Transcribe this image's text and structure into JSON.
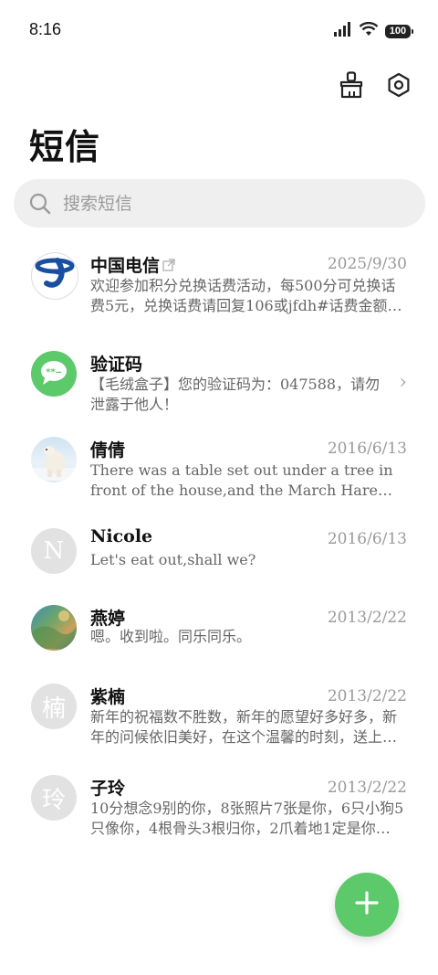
{
  "status": {
    "time": "8:16",
    "battery": "100"
  },
  "header": {
    "title": "短信"
  },
  "search": {
    "placeholder": "搜索短信"
  },
  "messages": [
    {
      "name": "中国电信",
      "date": "2025/9/30",
      "preview": "欢迎参加积分兑换话费活动，每500分可兑换话费5元，兑换话费请回复106或jfdh#话费金额…",
      "avatar": "china-telecom-logo"
    },
    {
      "name": "验证码",
      "date": "",
      "preview": "【毛绒盒子】您的验证码为：047588，请勿泄露于他人！",
      "avatar": "chat-bubble-icon"
    },
    {
      "name": "倩倩",
      "date": "2016/6/13",
      "preview": "There was a table set out under a tree in front of the house,and the March Hare and the Ha…",
      "avatar": "polar-bear-photo"
    },
    {
      "name": "Nicole",
      "date": "2016/6/13",
      "preview": "Let's eat out,shall we?",
      "avatar": "N"
    },
    {
      "name": "燕婷",
      "date": "2013/2/22",
      "preview": "嗯。收到啦。同乐同乐。",
      "avatar": "landscape-photo"
    },
    {
      "name": "紫楠",
      "date": "2013/2/22",
      "preview": "新年的祝福数不胜数，新年的愿望好多好多，新年的问候依旧美好，在这个温馨的时刻，送上…",
      "avatar": "楠"
    },
    {
      "name": "子玲",
      "date": "2013/2/22",
      "preview": "10分想念9别的你，8张照片7张是你，6只小狗5只像你，4根骨头3根归你，2爪着地1定是你…",
      "avatar": "玲"
    }
  ],
  "colors": {
    "accent": "#5cc96a",
    "telecom_blue": "#1a4fa0"
  }
}
